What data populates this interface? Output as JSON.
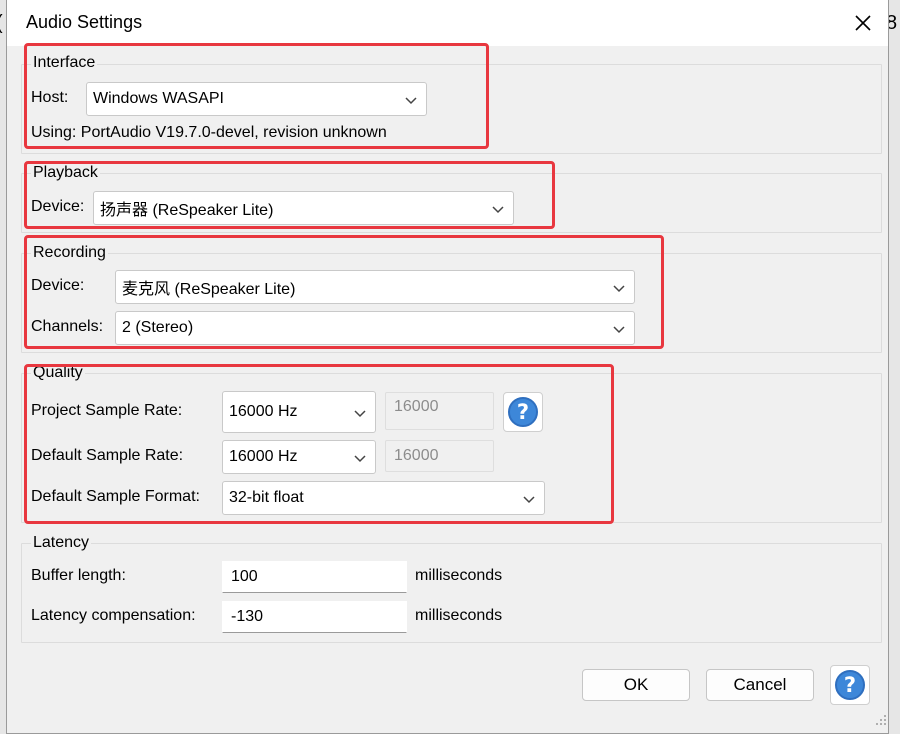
{
  "window": {
    "title": "Audio Settings"
  },
  "background_fragments": {
    "left": "(",
    "right": "8"
  },
  "interface": {
    "legend": "Interface",
    "host_label": "Host:",
    "host_value": "Windows WASAPI",
    "using_text": "Using: PortAudio V19.7.0-devel, revision unknown"
  },
  "playback": {
    "legend": "Playback",
    "device_label": "Device:",
    "device_value": "扬声器 (ReSpeaker Lite)"
  },
  "recording": {
    "legend": "Recording",
    "device_label": "Device:",
    "device_value": "麦克风 (ReSpeaker Lite)",
    "channels_label": "Channels:",
    "channels_value": "2 (Stereo)"
  },
  "quality": {
    "legend": "Quality",
    "project_rate_label": "Project Sample Rate:",
    "project_rate_value": "16000 Hz",
    "project_rate_custom": "16000",
    "default_rate_label": "Default Sample Rate:",
    "default_rate_value": "16000 Hz",
    "default_rate_custom": "16000",
    "format_label": "Default Sample Format:",
    "format_value": "32-bit float"
  },
  "latency": {
    "legend": "Latency",
    "buffer_label": "Buffer length:",
    "buffer_value": "100",
    "buffer_unit": "milliseconds",
    "compensation_label": "Latency compensation:",
    "compensation_value": "-130",
    "compensation_unit": "milliseconds"
  },
  "buttons": {
    "ok": "OK",
    "cancel": "Cancel",
    "help_glyph": "?"
  },
  "colors": {
    "highlight_box": "#e8373f",
    "help_blue": "#3d87d9",
    "dialog_bg": "#f0f0f0"
  },
  "icons": {
    "close": "close-icon",
    "dropdown": "chevron-down-icon",
    "help": "help-icon",
    "resize": "resize-grip-icon"
  }
}
